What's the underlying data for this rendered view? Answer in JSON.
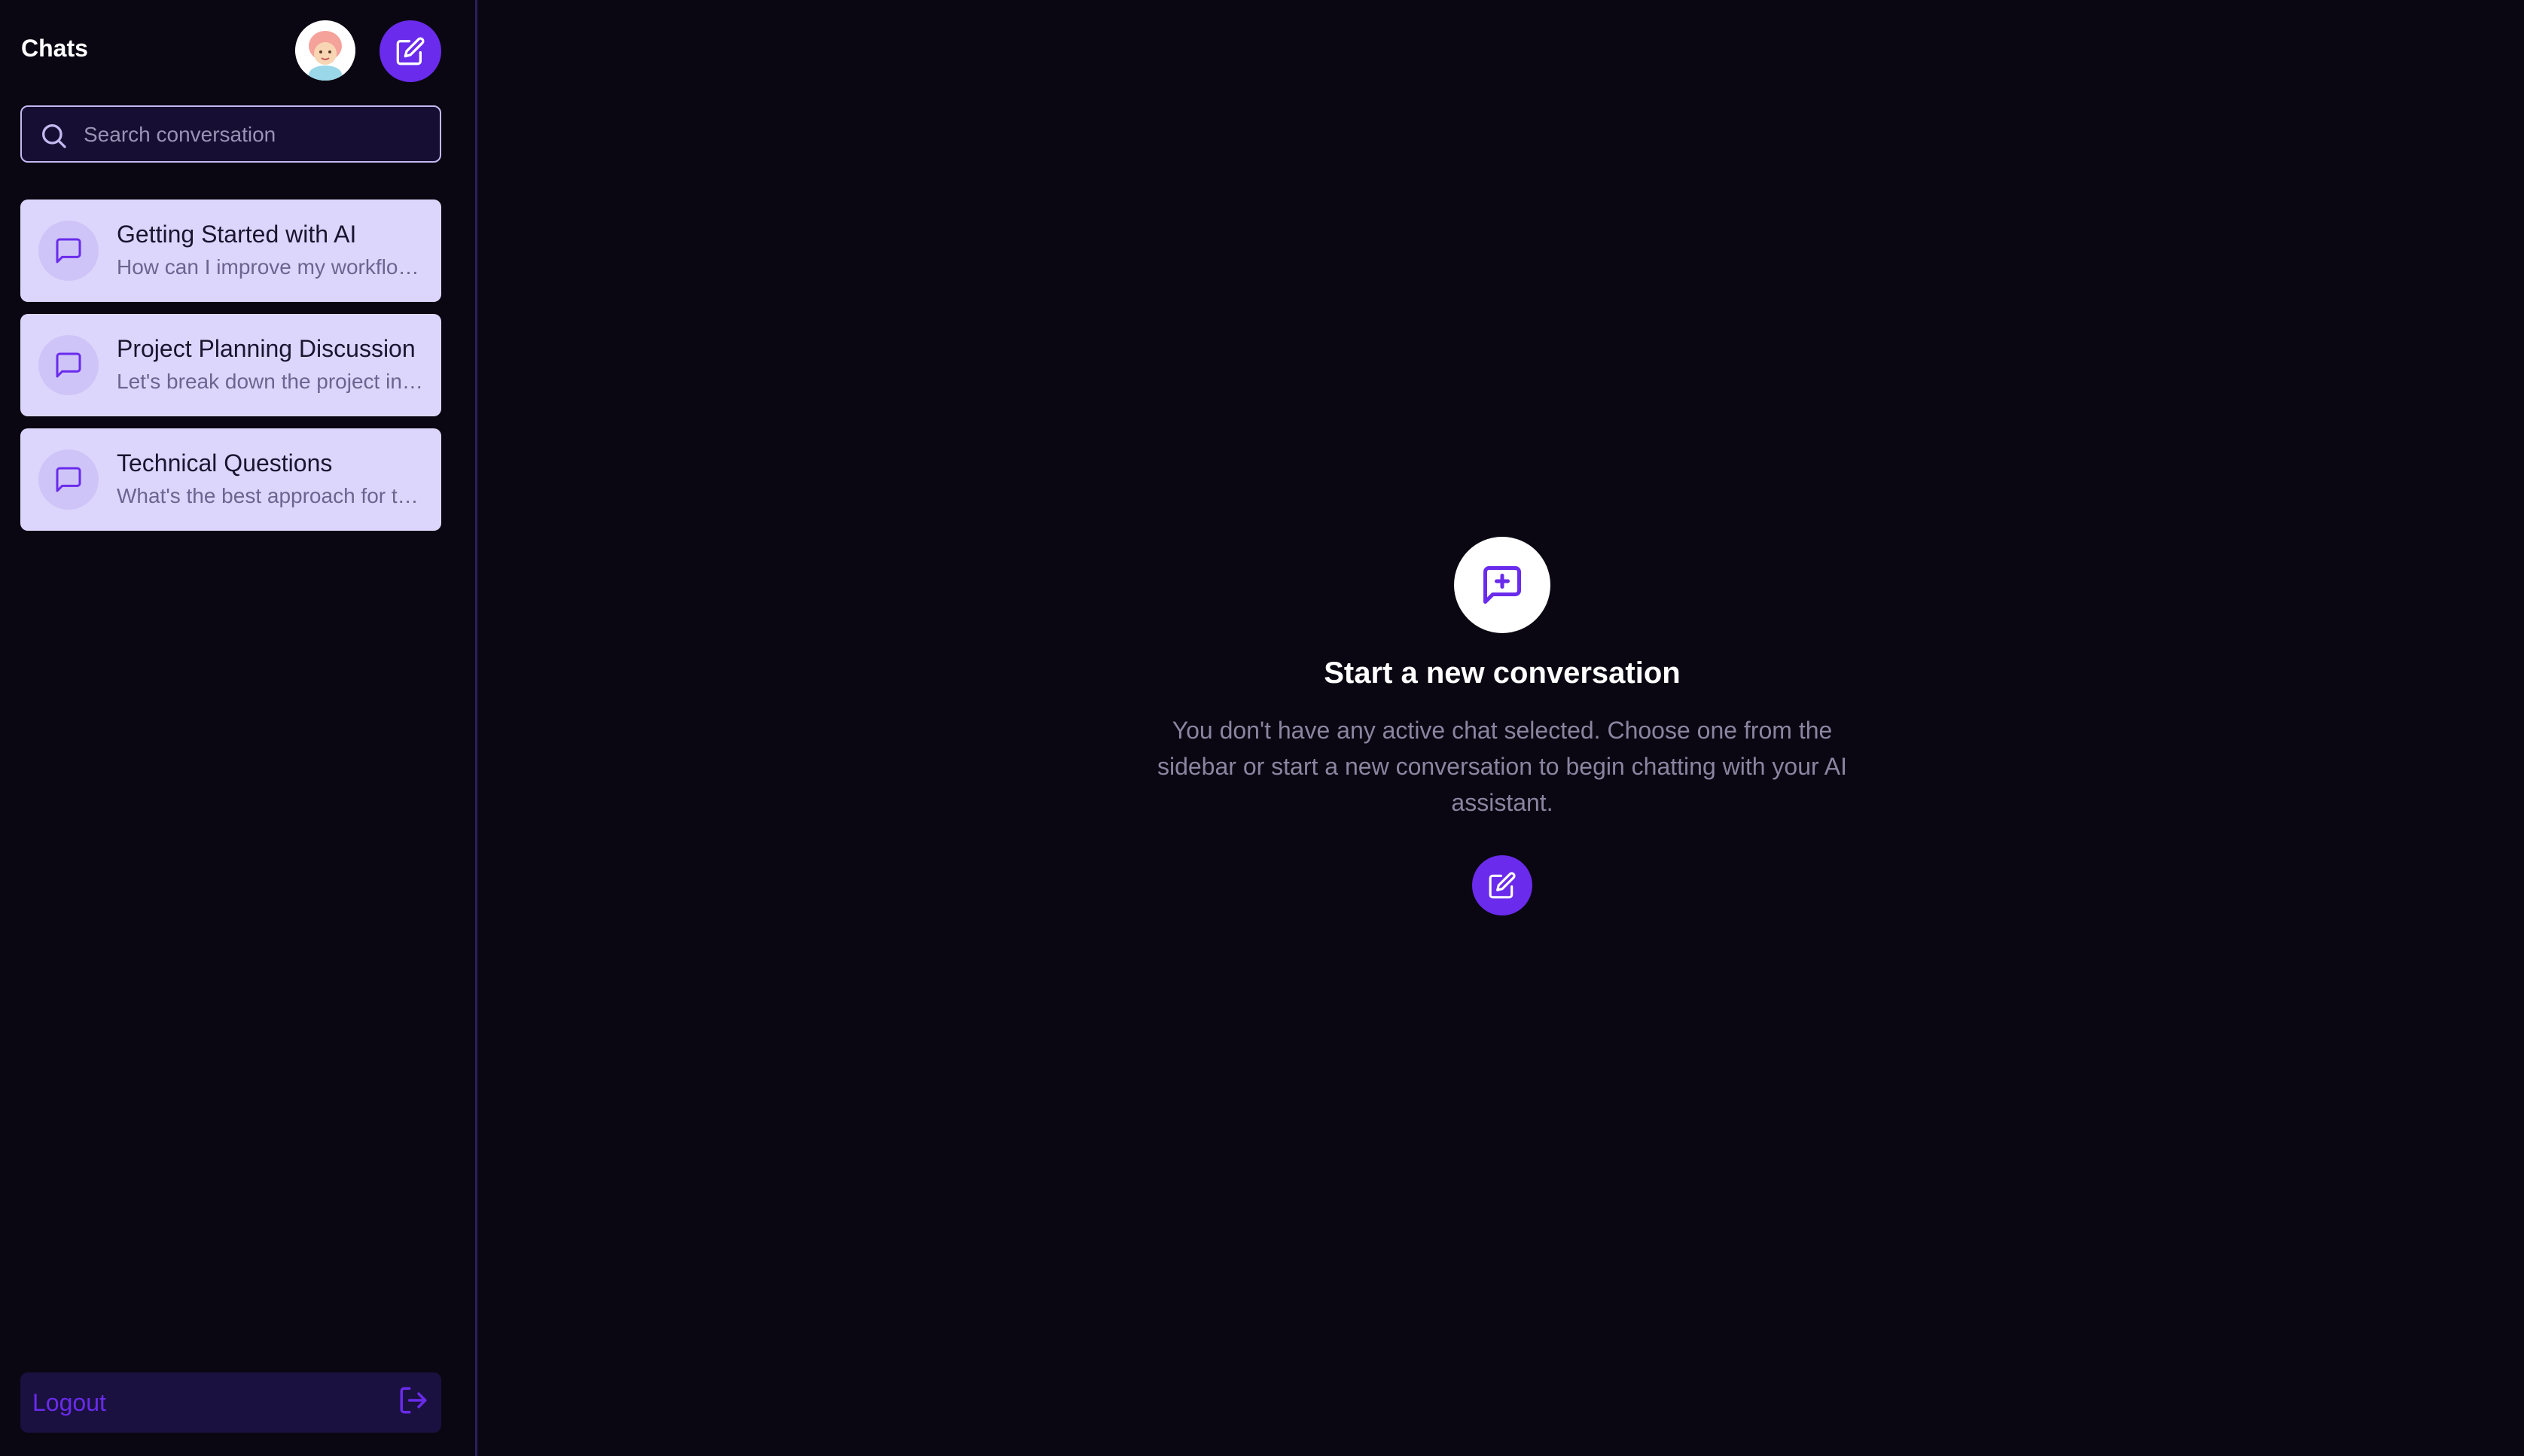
{
  "sidebar": {
    "title": "Chats",
    "search": {
      "placeholder": "Search conversation",
      "value": ""
    },
    "chats": [
      {
        "title": "Getting Started with AI",
        "preview": "How can I improve my workflow with AI tools?"
      },
      {
        "title": "Project Planning Discussion",
        "preview": "Let's break down the project into smaller tasks"
      },
      {
        "title": "Technical Questions",
        "preview": "What's the best approach for this problem?"
      }
    ],
    "logout_label": "Logout"
  },
  "icons": {
    "avatar": "avatar",
    "new_chat": "edit-icon",
    "search": "search-icon",
    "chat_item": "message-square-icon",
    "empty_state": "message-square-plus-icon",
    "logout": "logout-icon"
  },
  "main": {
    "empty_title": "Start a new conversation",
    "empty_description": "You don't have any active chat selected. Choose one from the sidebar or start a new conversation to begin chatting with your AI assistant."
  },
  "colors": {
    "background": "#0a0712",
    "accent": "#6a2bec",
    "chat_card": "#ddd6fc",
    "sidebar_border": "#2b1f63"
  }
}
